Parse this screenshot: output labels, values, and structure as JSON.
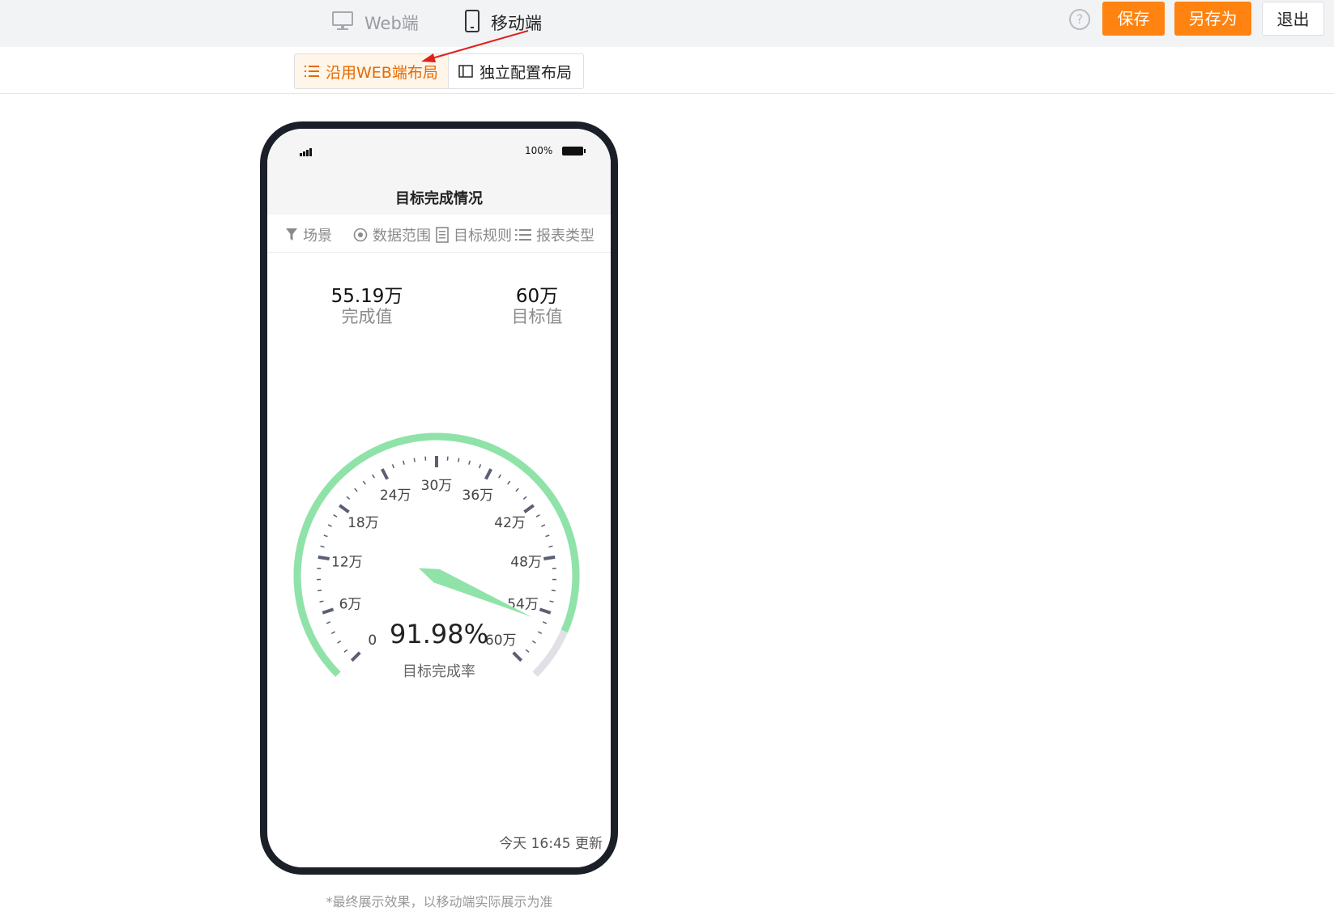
{
  "topbar": {
    "tab_web": "Web端",
    "tab_mobile": "移动端",
    "help": "?",
    "save": "保存",
    "save_as": "另存为",
    "exit": "退出"
  },
  "layout_switch": {
    "follow_web": "沿用WEB端布局",
    "independent": "独立配置布局"
  },
  "phone": {
    "battery": "100%",
    "title": "目标完成情况",
    "filters": [
      "场景",
      "数据范围",
      "目标规则",
      "报表类型"
    ],
    "kpis": {
      "actual_value": "55.19万",
      "actual_label": "完成值",
      "target_value": "60万",
      "target_label": "目标值"
    },
    "updated": "今天 16:45 更新"
  },
  "chart_data": {
    "type": "gauge",
    "min": 0,
    "max": 60,
    "value": 55.19,
    "tick_labels": [
      "0",
      "6万",
      "12万",
      "18万",
      "24万",
      "30万",
      "36万",
      "42万",
      "48万",
      "54万",
      "60万"
    ],
    "percent_text": "91.98%",
    "label": "目标完成率",
    "colors": {
      "progress": "#8fe3a8",
      "remaining": "#dfe1e6",
      "ticks": "#5b5f73",
      "pointer": "#8fe3a8"
    }
  },
  "footnote": "*最终展示效果，以移动端实际展示为准",
  "colors": {
    "accent": "#ff8310",
    "accent_text": "#e46a00"
  }
}
